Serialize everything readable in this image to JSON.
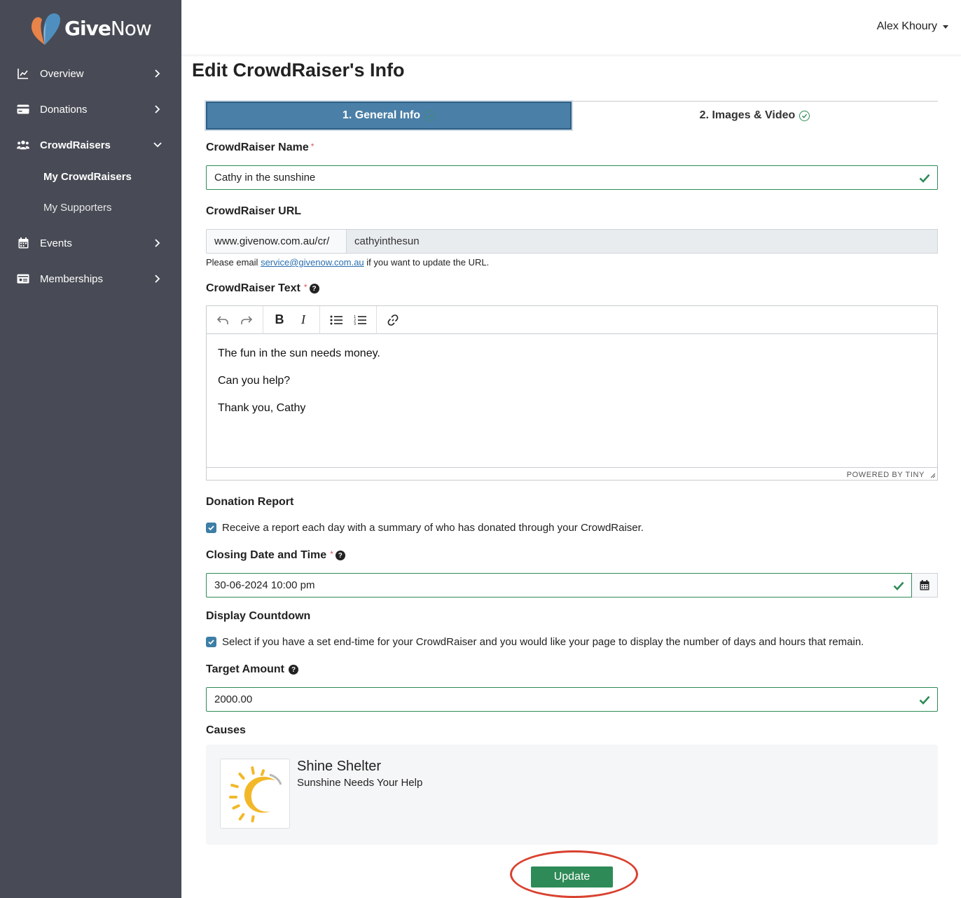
{
  "brand": {
    "name_bold": "Give",
    "name_light": "Now",
    "colors": {
      "orange": "#e8834a",
      "blue": "#4f8fc0"
    }
  },
  "sidebar": {
    "items": [
      {
        "label": "Overview",
        "icon": "chart-line-icon"
      },
      {
        "label": "Donations",
        "icon": "credit-card-icon"
      },
      {
        "label": "CrowdRaisers",
        "icon": "users-icon",
        "expanded": true
      },
      {
        "label": "Events",
        "icon": "calendar-icon"
      },
      {
        "label": "Memberships",
        "icon": "id-card-icon"
      }
    ],
    "subitems": [
      {
        "label": "My CrowdRaisers",
        "active": true
      },
      {
        "label": "My Supporters",
        "active": false
      }
    ]
  },
  "header": {
    "user_name": "Alex Khoury"
  },
  "page": {
    "title": "Edit CrowdRaiser's Info"
  },
  "tabs": [
    {
      "label": "1. General Info",
      "active": true
    },
    {
      "label": "2. Images & Video",
      "active": false
    }
  ],
  "form": {
    "name": {
      "label": "CrowdRaiser Name",
      "required": "*",
      "value": "Cathy in the sunshine"
    },
    "url": {
      "label": "CrowdRaiser URL",
      "prefix": "www.givenow.com.au/cr/",
      "value": "cathyinthesun",
      "help_before": "Please email",
      "help_email": "service@givenow.com.au",
      "help_after": "if you want to update the URL."
    },
    "text": {
      "label": "CrowdRaiser Text",
      "required": "*",
      "paragraphs": [
        "The fun in the sun needs money.",
        "Can you help?",
        "Thank you, Cathy"
      ],
      "powered_by": "POWERED BY TINY"
    },
    "donation_report": {
      "label": "Donation Report",
      "checkbox_label": "Receive a report each day with a summary of who has donated through your CrowdRaiser.",
      "checked": true
    },
    "closing": {
      "label": "Closing Date and Time",
      "required": "*",
      "value": "30-06-2024 10:00 pm"
    },
    "countdown": {
      "label": "Display Countdown",
      "checkbox_label": "Select if you have a set end-time for your CrowdRaiser and you would like your page to display the number of days and hours that remain.",
      "checked": true
    },
    "target": {
      "label": "Target Amount",
      "value": "2000.00"
    },
    "causes": {
      "label": "Causes",
      "items": [
        {
          "name": "Shine Shelter",
          "tagline": "Sunshine Needs Your Help"
        }
      ]
    },
    "submit_label": "Update"
  },
  "colors": {
    "sidebar_bg": "#484b55",
    "accent_blue": "#4a7fa7",
    "success_green": "#2e8b57",
    "annotation_red": "#d9412f"
  }
}
